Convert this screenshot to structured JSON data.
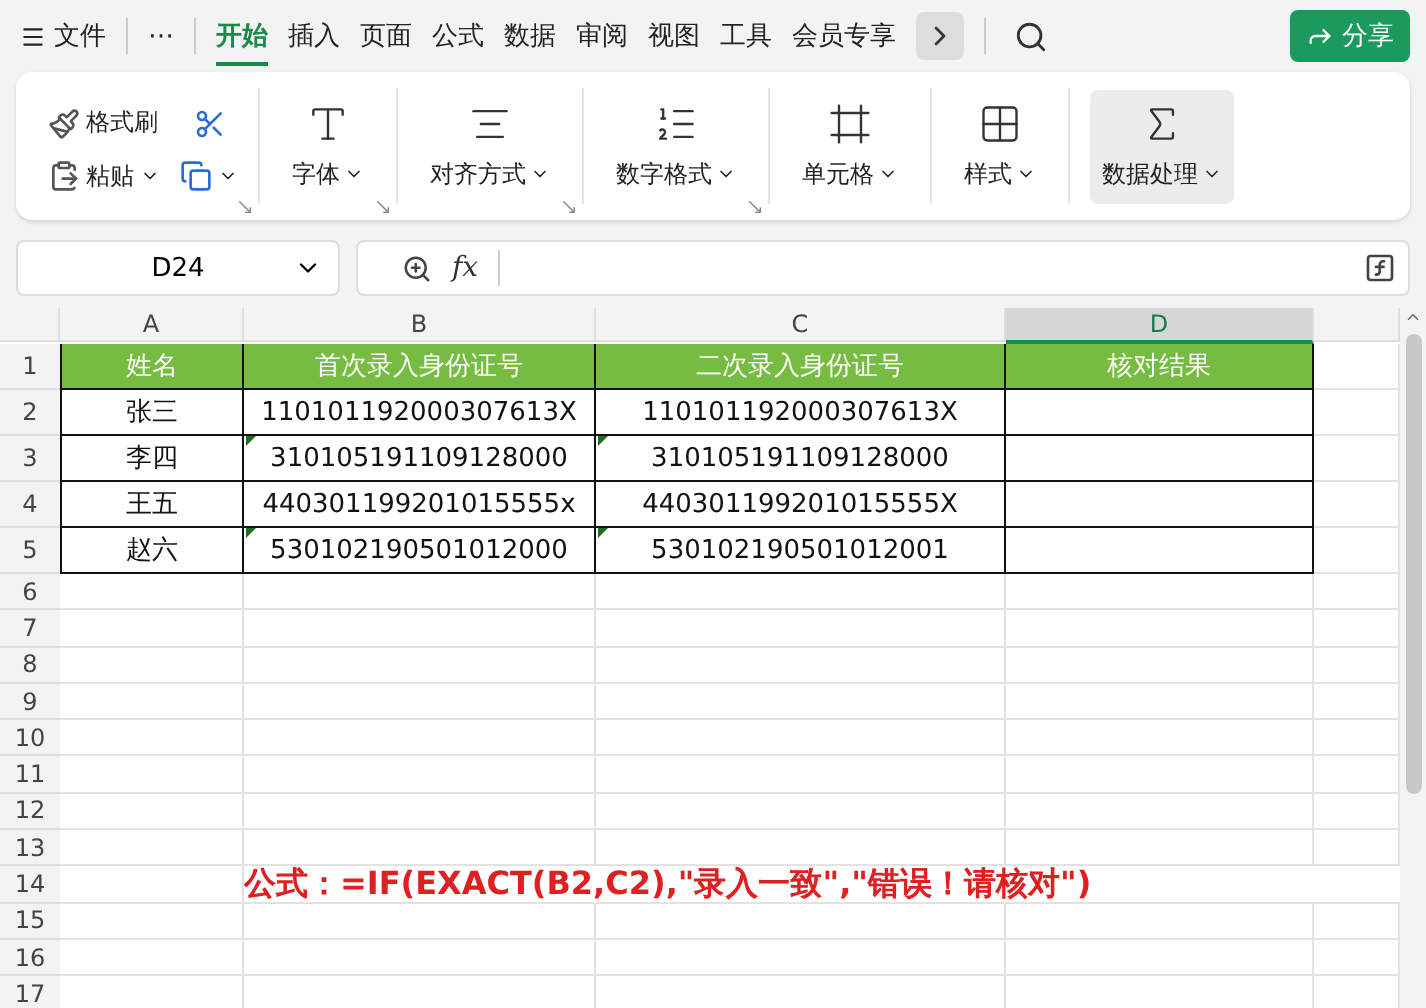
{
  "menu_bar": {
    "file": "文件",
    "more": "⋯",
    "tabs": [
      {
        "label": "开始",
        "selected": true
      },
      {
        "label": "插入",
        "selected": false
      },
      {
        "label": "页面",
        "selected": false
      },
      {
        "label": "公式",
        "selected": false
      },
      {
        "label": "数据",
        "selected": false
      },
      {
        "label": "审阅",
        "selected": false
      },
      {
        "label": "视图",
        "selected": false
      },
      {
        "label": "工具",
        "selected": false
      },
      {
        "label": "会员专享",
        "selected": false
      }
    ],
    "share_button": "分享"
  },
  "ribbon": {
    "clipboard": {
      "format_painter": "格式刷",
      "paste": "粘贴",
      "launcher": true
    },
    "groups": [
      {
        "kind": "font",
        "label": "字体",
        "highlighted": false,
        "launcher": true
      },
      {
        "kind": "align",
        "label": "对齐方式",
        "highlighted": false,
        "launcher": true
      },
      {
        "kind": "number",
        "label": "数字格式",
        "highlighted": false,
        "launcher": true
      },
      {
        "kind": "cell",
        "label": "单元格",
        "highlighted": false,
        "launcher": false
      },
      {
        "kind": "style",
        "label": "样式",
        "highlighted": false,
        "launcher": false
      },
      {
        "kind": "data",
        "label": "数据处理",
        "highlighted": true,
        "launcher": false
      }
    ]
  },
  "formula_bar": {
    "name_box": "D24",
    "fx": "fx"
  },
  "sheet": {
    "columns": [
      {
        "label": "A",
        "selected": false
      },
      {
        "label": "B",
        "selected": false
      },
      {
        "label": "C",
        "selected": false
      },
      {
        "label": "D",
        "selected": true
      }
    ],
    "rows": [
      {
        "number": "1",
        "kind": "header",
        "cells": [
          {
            "text": "姓名",
            "flagged": false
          },
          {
            "text": "首次录入身份证号",
            "flagged": false
          },
          {
            "text": "二次录入身份证号",
            "flagged": false
          },
          {
            "text": "核对结果",
            "flagged": false
          }
        ]
      },
      {
        "number": "2",
        "kind": "data",
        "cells": [
          {
            "text": "张三",
            "flagged": false
          },
          {
            "text": "110101192000307613X",
            "flagged": false
          },
          {
            "text": "110101192000307613X",
            "flagged": false
          }
        ]
      },
      {
        "number": "3",
        "kind": "data",
        "cells": [
          {
            "text": "李四",
            "flagged": false
          },
          {
            "text": "310105191109128000",
            "flagged": true
          },
          {
            "text": "310105191109128000",
            "flagged": true
          }
        ]
      },
      {
        "number": "4",
        "kind": "data",
        "cells": [
          {
            "text": "王五",
            "flagged": false
          },
          {
            "text": "440301199201015555x",
            "flagged": false
          },
          {
            "text": "440301199201015555X",
            "flagged": false
          }
        ]
      },
      {
        "number": "5",
        "kind": "data",
        "cells": [
          {
            "text": "赵六",
            "flagged": false
          },
          {
            "text": "530102190501012000",
            "flagged": true
          },
          {
            "text": "530102190501012001",
            "flagged": true
          }
        ]
      },
      {
        "number": "6",
        "kind": "empty"
      },
      {
        "number": "7",
        "kind": "empty"
      },
      {
        "number": "8",
        "kind": "empty"
      },
      {
        "number": "9",
        "kind": "empty"
      },
      {
        "number": "10",
        "kind": "empty"
      },
      {
        "number": "11",
        "kind": "empty"
      },
      {
        "number": "12",
        "kind": "empty"
      },
      {
        "number": "13",
        "kind": "empty"
      },
      {
        "number": "14",
        "kind": "note"
      },
      {
        "number": "15",
        "kind": "empty"
      },
      {
        "number": "16",
        "kind": "empty"
      },
      {
        "number": "17",
        "kind": "empty"
      }
    ],
    "annotation": "公式：=IF(EXACT(B2,C2),\"录入一致\",\"错误！请核对\")"
  }
}
